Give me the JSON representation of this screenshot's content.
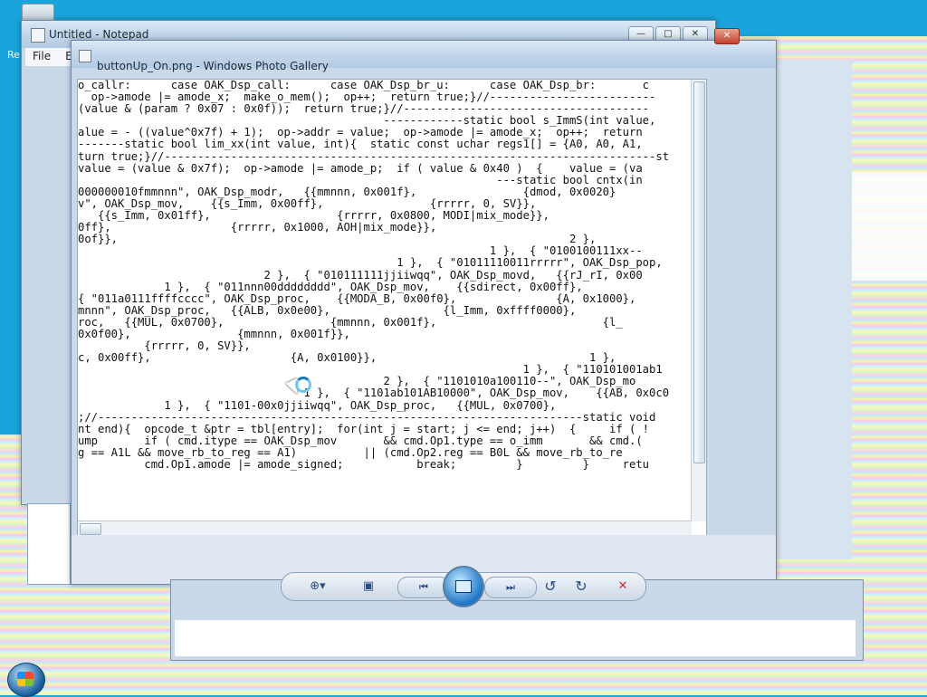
{
  "desktop": {
    "icon_name": "recycle-bin-icon",
    "label_fragment": "Re"
  },
  "notepad": {
    "title": "Untitled - Notepad",
    "menu": [
      "File",
      "E"
    ],
    "controls": [
      "minimize",
      "maximize",
      "close"
    ]
  },
  "gallery": {
    "title": "buttonUp_On.png - Windows Photo Gallery",
    "code_lines": [
      "o_callr:      case OAK_Dsp_call:      case OAK_Dsp_br_u:      case OAK_Dsp_br:       c",
      "  op->amode |= amode_x;  make_o_mem();  op++;  return true;}//-------------------------",
      "(value & (param ? 0x07 : 0x0f));  return true;}//-------------------------------------",
      "                                              ------------static bool s_ImmS(int value,",
      "alue = - ((value^0x7f) + 1);  op->addr = value;  op->amode |= amode_x;  op++;  return",
      "-------static bool lim_xx(int value, int){  static const uchar regs1[] = {A0, A0, A1,",
      "turn true;}//--------------------------------------------------------------------------st",
      "value = (value & 0x7f);  op->amode |= amode_p;  if ( value & 0x40 )  {    value = (va",
      "                                                               ---static bool cntx(in",
      "000000010fmmnnn\", OAK_Dsp_modr,   {{mmnnn, 0x001f},                {dmod, 0x0020}",
      "v\", OAK_Dsp_mov,    {{s_Imm, 0x00ff},                {rrrrr, 0, SV}},",
      "   {{s_Imm, 0x01ff},                   {rrrrr, 0x0800, MODI|mix_mode}},",
      "0ff},                  {rrrrr, 0x1000, AOH|mix_mode}},",
      "",
      "0of}},                                                                    2 },",
      "                                                              1 },  { \"0100100111xx--",
      "                                                1 },  { \"01011110011rrrrr\", OAK_Dsp_pop,",
      "                            2 },  { \"010111111jjiiwqq\", OAK_Dsp_movd,   {{rJ_rI, 0x00",
      "             1 },  { \"011nnn00dddddddd\", OAK_Dsp_mov,    {{sdirect, 0x00ff},",
      "{ \"011a0111ffffcccc\", OAK_Dsp_proc,    {{MODA_B, 0x00f0},               {A, 0x1000},",
      "mnnn\", OAK_Dsp_proc,   {{ALB, 0x0e00},                 {l_Imm, 0xffff0000},",
      "roc,   {{MUL, 0x0700},                {mmnnn, 0x001f},                         {l_",
      "0x0f00},                {mmnnn, 0x001f}},",
      "          {rrrrr, 0, SV}},",
      "c, 0x00ff},                     {A, 0x0100}},                                1 },",
      "                                                                   1 },  { \"110101001ab1",
      "                                              2 },  { \"1101010a100110--\", OAK_Dsp_mo",
      "                                  1 },  { \"1101ab101AB10000\", OAK_Dsp_mov,    {{AB, 0x0c0",
      "             1 },  { \"1101-00x0jjiiwqq\", OAK_Dsp_proc,   {{MUL, 0x0700},",
      ";//-------------------------------------------------------------------------static void",
      "nt end){  opcode_t &ptr = tbl[entry];  for(int j = start; j <= end; j++)  {     if ( !",
      "ump       if ( cmd.itype == OAK_Dsp_mov       && cmd.Op1.type == o_imm       && cmd.(",
      "g == A1L && move_rb_to_reg == A1)          || (cmd.Op2.reg == B0L && move_rb_to_re",
      "          cmd.Op1.amode |= amode_signed;           break;         }         }     retu"
    ],
    "toolbar": {
      "zoom_label": "⊕▾",
      "fit_label": "▣",
      "prev_label": "⏮",
      "next_label": "⏭",
      "rotate_ccw_label": "↺",
      "rotate_cw_label": "↻",
      "delete_label": "✕"
    }
  }
}
